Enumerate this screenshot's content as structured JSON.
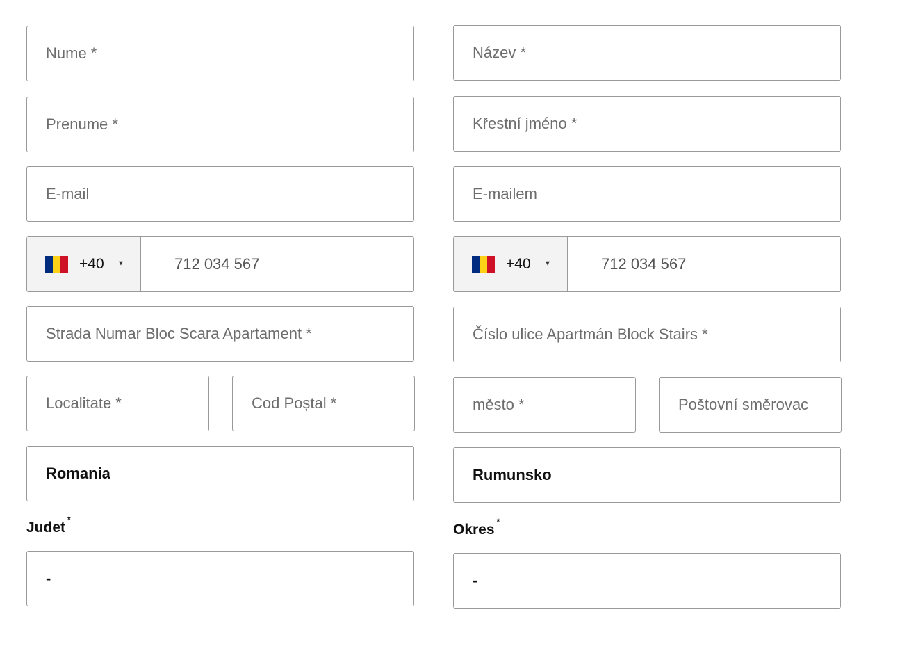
{
  "left": {
    "last_name": "Nume *",
    "first_name": "Prenume *",
    "email": "E-mail",
    "phone": {
      "country_code": "+40",
      "number_placeholder": "712 034 567"
    },
    "street": "Strada Numar Bloc Scara Apartament *",
    "city": "Localitate *",
    "postal_code": "Cod Poștal *",
    "country": "Romania",
    "region_label": "Judet",
    "required_mark": "*",
    "region_value": "-"
  },
  "right": {
    "last_name": "Název *",
    "first_name": "Křestní jméno *",
    "email": "E-mailem",
    "phone": {
      "country_code": "+40",
      "number_placeholder": "712 034 567"
    },
    "street": "Číslo ulice Apartmán Block Stairs *",
    "city": "město *",
    "postal_code": "Poštovní směrovac",
    "country": "Rumunsko",
    "region_label": "Okres",
    "required_mark": "*",
    "region_value": "-"
  },
  "colors": {
    "flag_blue": "#002B7F",
    "flag_yellow": "#FCD116",
    "flag_red": "#CE1126",
    "border": "#9a9a9a"
  },
  "icons": {
    "flag": "romania-flag-icon",
    "caret": "caret-down-icon"
  }
}
